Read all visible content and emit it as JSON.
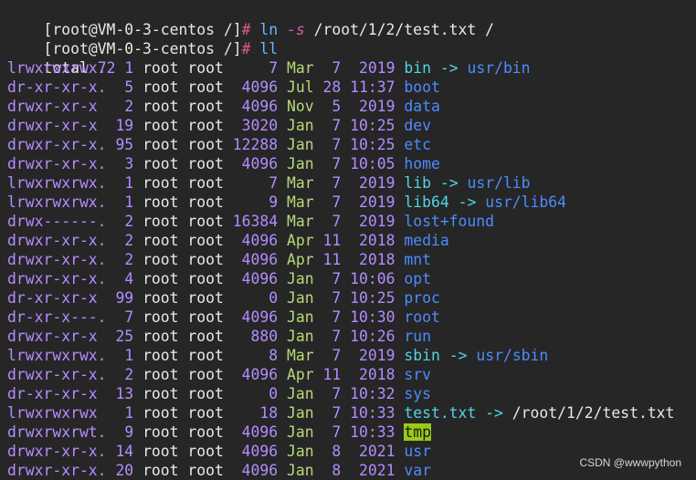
{
  "prompt1": "[root@VM-0-3-centos /]",
  "prompt2": "[root@VM-0-3-centos /]",
  "caret": "#",
  "cmd1": {
    "cmd": "ln",
    "flag": "-s",
    "args": "/root/1/2/test.txt /"
  },
  "cmd2": {
    "cmd": "ll"
  },
  "total": {
    "label": "total",
    "value": "72"
  },
  "rows": [
    {
      "perm": "lrwxrwxrwx.",
      "links": "1",
      "owner": "root",
      "group": "root",
      "size": "7",
      "mon": "Mar",
      "day": "7",
      "yt": "2019",
      "name": "bin",
      "kind": "link",
      "arrow": "->",
      "target": "usr/bin"
    },
    {
      "perm": "dr-xr-xr-x.",
      "links": "5",
      "owner": "root",
      "group": "root",
      "size": "4096",
      "mon": "Jul",
      "day": "28",
      "yt": "11:37",
      "name": "boot",
      "kind": "dir"
    },
    {
      "perm": "drwxr-xr-x",
      "links": "2",
      "owner": "root",
      "group": "root",
      "size": "4096",
      "mon": "Nov",
      "day": "5",
      "yt": "2019",
      "name": "data",
      "kind": "dir"
    },
    {
      "perm": "drwxr-xr-x",
      "links": "19",
      "owner": "root",
      "group": "root",
      "size": "3020",
      "mon": "Jan",
      "day": "7",
      "yt": "10:25",
      "name": "dev",
      "kind": "dir"
    },
    {
      "perm": "drwxr-xr-x.",
      "links": "95",
      "owner": "root",
      "group": "root",
      "size": "12288",
      "mon": "Jan",
      "day": "7",
      "yt": "10:25",
      "name": "etc",
      "kind": "dir"
    },
    {
      "perm": "drwxr-xr-x.",
      "links": "3",
      "owner": "root",
      "group": "root",
      "size": "4096",
      "mon": "Jan",
      "day": "7",
      "yt": "10:05",
      "name": "home",
      "kind": "dir"
    },
    {
      "perm": "lrwxrwxrwx.",
      "links": "1",
      "owner": "root",
      "group": "root",
      "size": "7",
      "mon": "Mar",
      "day": "7",
      "yt": "2019",
      "name": "lib",
      "kind": "link",
      "arrow": "->",
      "target": "usr/lib"
    },
    {
      "perm": "lrwxrwxrwx.",
      "links": "1",
      "owner": "root",
      "group": "root",
      "size": "9",
      "mon": "Mar",
      "day": "7",
      "yt": "2019",
      "name": "lib64",
      "kind": "link",
      "arrow": "->",
      "target": "usr/lib64"
    },
    {
      "perm": "drwx------.",
      "links": "2",
      "owner": "root",
      "group": "root",
      "size": "16384",
      "mon": "Mar",
      "day": "7",
      "yt": "2019",
      "name": "lost+found",
      "kind": "dir"
    },
    {
      "perm": "drwxr-xr-x.",
      "links": "2",
      "owner": "root",
      "group": "root",
      "size": "4096",
      "mon": "Apr",
      "day": "11",
      "yt": "2018",
      "name": "media",
      "kind": "dir"
    },
    {
      "perm": "drwxr-xr-x.",
      "links": "2",
      "owner": "root",
      "group": "root",
      "size": "4096",
      "mon": "Apr",
      "day": "11",
      "yt": "2018",
      "name": "mnt",
      "kind": "dir"
    },
    {
      "perm": "drwxr-xr-x.",
      "links": "4",
      "owner": "root",
      "group": "root",
      "size": "4096",
      "mon": "Jan",
      "day": "7",
      "yt": "10:06",
      "name": "opt",
      "kind": "dir"
    },
    {
      "perm": "dr-xr-xr-x",
      "links": "99",
      "owner": "root",
      "group": "root",
      "size": "0",
      "mon": "Jan",
      "day": "7",
      "yt": "10:25",
      "name": "proc",
      "kind": "dir"
    },
    {
      "perm": "dr-xr-x---.",
      "links": "7",
      "owner": "root",
      "group": "root",
      "size": "4096",
      "mon": "Jan",
      "day": "7",
      "yt": "10:30",
      "name": "root",
      "kind": "dir"
    },
    {
      "perm": "drwxr-xr-x",
      "links": "25",
      "owner": "root",
      "group": "root",
      "size": "880",
      "mon": "Jan",
      "day": "7",
      "yt": "10:26",
      "name": "run",
      "kind": "dir"
    },
    {
      "perm": "lrwxrwxrwx.",
      "links": "1",
      "owner": "root",
      "group": "root",
      "size": "8",
      "mon": "Mar",
      "day": "7",
      "yt": "2019",
      "name": "sbin",
      "kind": "link",
      "arrow": "->",
      "target": "usr/sbin"
    },
    {
      "perm": "drwxr-xr-x.",
      "links": "2",
      "owner": "root",
      "group": "root",
      "size": "4096",
      "mon": "Apr",
      "day": "11",
      "yt": "2018",
      "name": "srv",
      "kind": "dir"
    },
    {
      "perm": "dr-xr-xr-x",
      "links": "13",
      "owner": "root",
      "group": "root",
      "size": "0",
      "mon": "Jan",
      "day": "7",
      "yt": "10:32",
      "name": "sys",
      "kind": "dir"
    },
    {
      "perm": "lrwxrwxrwx",
      "links": "1",
      "owner": "root",
      "group": "root",
      "size": "18",
      "mon": "Jan",
      "day": "7",
      "yt": "10:33",
      "name": "test.txt",
      "kind": "link",
      "arrow": "->",
      "target": "/root/1/2/test.txt",
      "targetPlain": true
    },
    {
      "perm": "drwxrwxrwt.",
      "links": "9",
      "owner": "root",
      "group": "root",
      "size": "4096",
      "mon": "Jan",
      "day": "7",
      "yt": "10:33",
      "name": "tmp",
      "kind": "sticky"
    },
    {
      "perm": "drwxr-xr-x.",
      "links": "14",
      "owner": "root",
      "group": "root",
      "size": "4096",
      "mon": "Jan",
      "day": "8",
      "yt": "2021",
      "name": "usr",
      "kind": "dir"
    },
    {
      "perm": "drwxr-xr-x.",
      "links": "20",
      "owner": "root",
      "group": "root",
      "size": "4096",
      "mon": "Jan",
      "day": "8",
      "yt": "2021",
      "name": "var",
      "kind": "dir"
    }
  ],
  "watermark": "CSDN @wwwpython"
}
